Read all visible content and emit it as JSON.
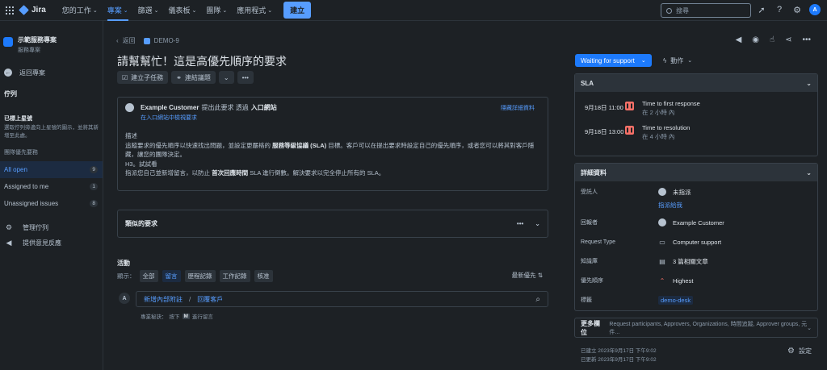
{
  "topbar": {
    "product": "Jira",
    "nav": [
      {
        "label": "您的工作",
        "active": false
      },
      {
        "label": "專案",
        "active": true
      },
      {
        "label": "篩選",
        "active": false
      },
      {
        "label": "儀表板",
        "active": false
      },
      {
        "label": "團隊",
        "active": false
      },
      {
        "label": "應用程式",
        "active": false
      }
    ],
    "create_label": "建立",
    "search_placeholder": "搜尋",
    "avatar_initial": "A"
  },
  "sidebar": {
    "project_name": "示範服務專案",
    "project_type": "服務專案",
    "back_label": "返回專案",
    "section_title": "佇列",
    "starred_title": "已標上星號",
    "starred_desc": "選取佇列旁邊向上星號的圖示，並將其新增至此處。",
    "group_title": "團隊優先要務",
    "queues": [
      {
        "label": "All open",
        "count": "9",
        "active": true
      },
      {
        "label": "Assigned to me",
        "count": "1",
        "active": false
      },
      {
        "label": "Unassigned issues",
        "count": "8",
        "active": false
      }
    ],
    "manage_label": "管理佇列",
    "feedback_label": "提供意見反應"
  },
  "issue": {
    "back_label": "返回",
    "key": "DEMO-9",
    "title": "請幫幫忙！這是高優先順序的要求",
    "actions": {
      "create_subtask": "建立子任務",
      "link_issue": "連結議題"
    },
    "request": {
      "reporter": "Example Customer",
      "raised_via": "提出此要求 透過",
      "channel": "入口網站",
      "portal_link": "在入口網站中檢視要求",
      "hide_details": "隱藏詳細資料",
      "desc_label": "描述",
      "desc_line1_a": "追蹤要求的優先順序以快速找出問題，並設定更嚴格的",
      "desc_line1_bold": "服務等級協議 (SLA)",
      "desc_line1_b": "目標。客戶可以在提出要求時設定自己的優先順序，或者您可以將其對客戶隱藏，讓您的團隊決定。",
      "desc_line2": "H3。試試看",
      "desc_line3_a": "指派您自己並新增留言，以防止",
      "desc_line3_bold": "首次回應時間",
      "desc_line3_b": "SLA 進行倒數。解決要求以完全停止所有的 SLA。"
    },
    "similar_label": "類似的要求",
    "activity": {
      "title": "活動",
      "show_label": "顯示：",
      "filters": [
        {
          "label": "全部",
          "active": false
        },
        {
          "label": "留言",
          "active": true
        },
        {
          "label": "歷程記錄",
          "active": false
        },
        {
          "label": "工作記錄",
          "active": false
        },
        {
          "label": "核准",
          "active": false
        }
      ],
      "sort_label": "最新優先 ⇅",
      "commenter_initial": "A",
      "add_internal_note": "新增內部附註",
      "separator": "/",
      "reply_customer": "回覆客戶",
      "tip_prefix": "專業秘訣：",
      "tip_press": "按下",
      "tip_key": "M",
      "tip_suffix": "進行留言"
    }
  },
  "right": {
    "status_label": "Waiting for support",
    "action_label": "動作",
    "sla": {
      "title": "SLA",
      "items": [
        {
          "time": "9月18日 11:00",
          "name": "Time to first response",
          "remaining": "在 2 小時 內"
        },
        {
          "time": "9月18日 13:00",
          "name": "Time to resolution",
          "remaining": "在 4 小時 內"
        }
      ]
    },
    "details": {
      "title": "詳細資料",
      "assignee_label": "受託人",
      "assignee_value": "未指派",
      "assign_to_me": "指派給我",
      "reporter_label": "回報者",
      "reporter_value": "Example Customer",
      "request_type_label": "Request Type",
      "request_type_value": "Computer support",
      "kb_label": "知識庫",
      "kb_value": "3 篇相關文章",
      "priority_label": "優先順序",
      "priority_value": "Highest",
      "labels_label": "標籤",
      "labels_value": "demo-desk"
    },
    "more_fields": {
      "title": "更多欄位",
      "summary": "Request participants, Approvers, Organizations, 時間追蹤, Approver groups, 元件..."
    },
    "created": "已建立 2023年9月17日 下午9:02",
    "updated": "已更新 2023年9月17日 下午9:02",
    "settings_label": "設定"
  },
  "colors": {
    "background": "#1d2125",
    "accent": "#579dff",
    "status_button": "#1d7afc",
    "sla_pause": "#f87168"
  }
}
